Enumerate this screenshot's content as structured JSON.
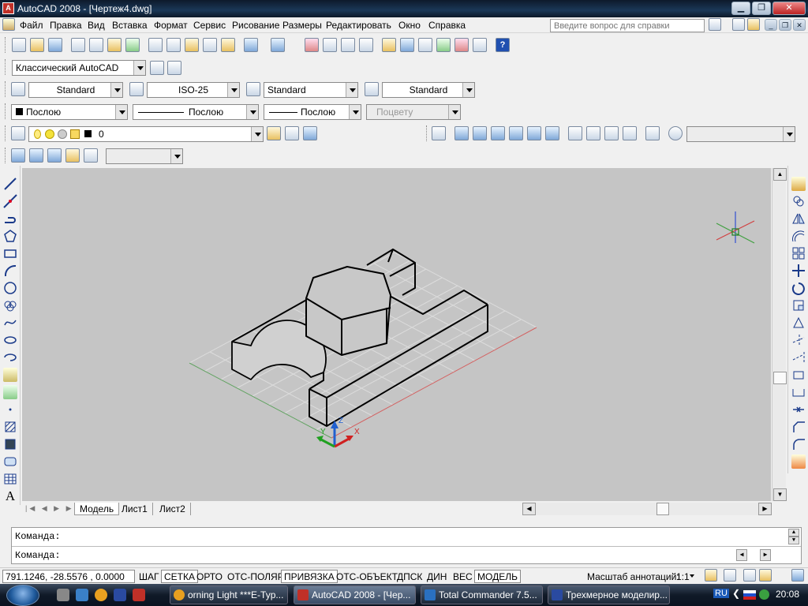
{
  "window": {
    "title": "AutoCAD 2008 - [Чертеж4.dwg]",
    "icon": "autocad-icon",
    "minimize": "▁",
    "restore": "❐",
    "close": "✕"
  },
  "menu": {
    "items": [
      "Файл",
      "Правка",
      "Вид",
      "Вставка",
      "Формат",
      "Сервис",
      "Рисование",
      "Размеры",
      "Редактировать",
      "Окно",
      "Справка"
    ],
    "help_placeholder": "Введите вопрос для справки"
  },
  "workspace": {
    "name": "Классический AutoCAD"
  },
  "styles": {
    "text_style": "Standard",
    "dim_style": "ISO-25",
    "table_style": "Standard",
    "mleader_style": "Standard"
  },
  "properties": {
    "color": "Послою",
    "linetype": "Послою",
    "lineweight": "Послою",
    "plotstyle": "Поцвету"
  },
  "layer": {
    "name": "0"
  },
  "tabs": [
    "Модель",
    "Лист1",
    "Лист2"
  ],
  "command": {
    "line1": "Команда:",
    "line2": "Команда:"
  },
  "status": {
    "coords": "791.1246, -28.5576 , 0.0000",
    "buttons": [
      "ШАГ",
      "СЕТКА",
      "ОРТО",
      "ОТС-ПОЛЯР",
      "ПРИВЯЗКА",
      "ОТС-ОБЪЕКТ",
      "ДПСК",
      "ДИН",
      "ВЕС",
      "МОДЕЛЬ"
    ],
    "active": [
      "СЕТКА",
      "ПРИВЯЗКА",
      "МОДЕЛЬ"
    ],
    "annot_label": "Масштаб аннотаций:",
    "annot_scale": "1:1"
  },
  "ucs": {
    "x": "X",
    "y": "Y",
    "z": "Z"
  },
  "taskbar": {
    "tasks": [
      "orning Light ***E-Typ...",
      "AutoCAD 2008 - [Чер...",
      "Total Commander 7.5...",
      "Трехмерное моделир..."
    ],
    "lang": "RU",
    "time": "20:08"
  },
  "colors": {
    "viewport": "#c5c5c5",
    "titlebar": "#1b3858",
    "x_axis": "#d02020",
    "y_axis": "#20a020",
    "z_axis": "#2060d0"
  }
}
